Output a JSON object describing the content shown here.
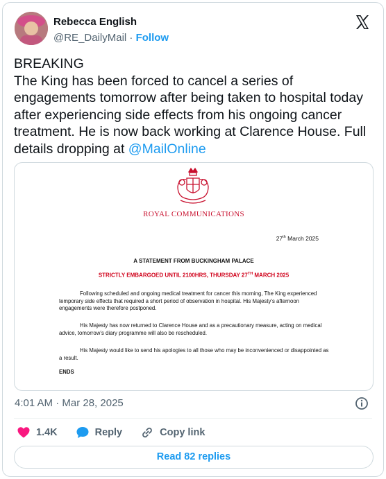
{
  "author": {
    "name": "Rebecca English",
    "handle": "@RE_DailyMail",
    "separator": " · ",
    "follow_label": "Follow"
  },
  "tweet": {
    "text": "BREAKING\nThe King has been forced to cancel a series of engagements tomorrow after being taken to hospital today after experiencing side effects from his ongoing cancer treatment. He is now back working at Clarence House. Full details dropping at ",
    "mention": "@MailOnline"
  },
  "document": {
    "header": "ROYAL COMMUNICATIONS",
    "date_day": "27",
    "date_suffix": "th",
    "date_rest": " March 2025",
    "statement_title": "A STATEMENT FROM BUCKINGHAM PALACE",
    "embargo_prefix": "STRICTLY EMBARGOED UNTIL 2100HRS, THURSDAY 27",
    "embargo_suffix": "TH",
    "embargo_rest": " MARCH 2025",
    "para1": "Following scheduled and ongoing medical treatment for cancer this morning, The King experienced temporary side effects that required a short period of observation in hospital. His Majesty’s afternoon engagements were therefore postponed.",
    "para2": "His Majesty has now returned to Clarence House and as a precautionary measure, acting on medical advice, tomorrow’s diary programme will also be rescheduled.",
    "para3": "His Majesty would like to send his apologies to all those who may be inconvenienced or disappointed as a result.",
    "ends": "ENDS"
  },
  "meta": {
    "timestamp": "4:01 AM · Mar 28, 2025"
  },
  "actions": {
    "likes": "1.4K",
    "reply_label": "Reply",
    "copy_link_label": "Copy link",
    "read_replies_label": "Read 82 replies"
  },
  "colors": {
    "accent": "#1d9bf0",
    "like": "#f91880",
    "royal_red": "#c8102e"
  },
  "icons": [
    "x-logo-icon",
    "royal-crest-icon",
    "info-icon",
    "heart-icon",
    "reply-bubble-icon",
    "link-icon"
  ]
}
